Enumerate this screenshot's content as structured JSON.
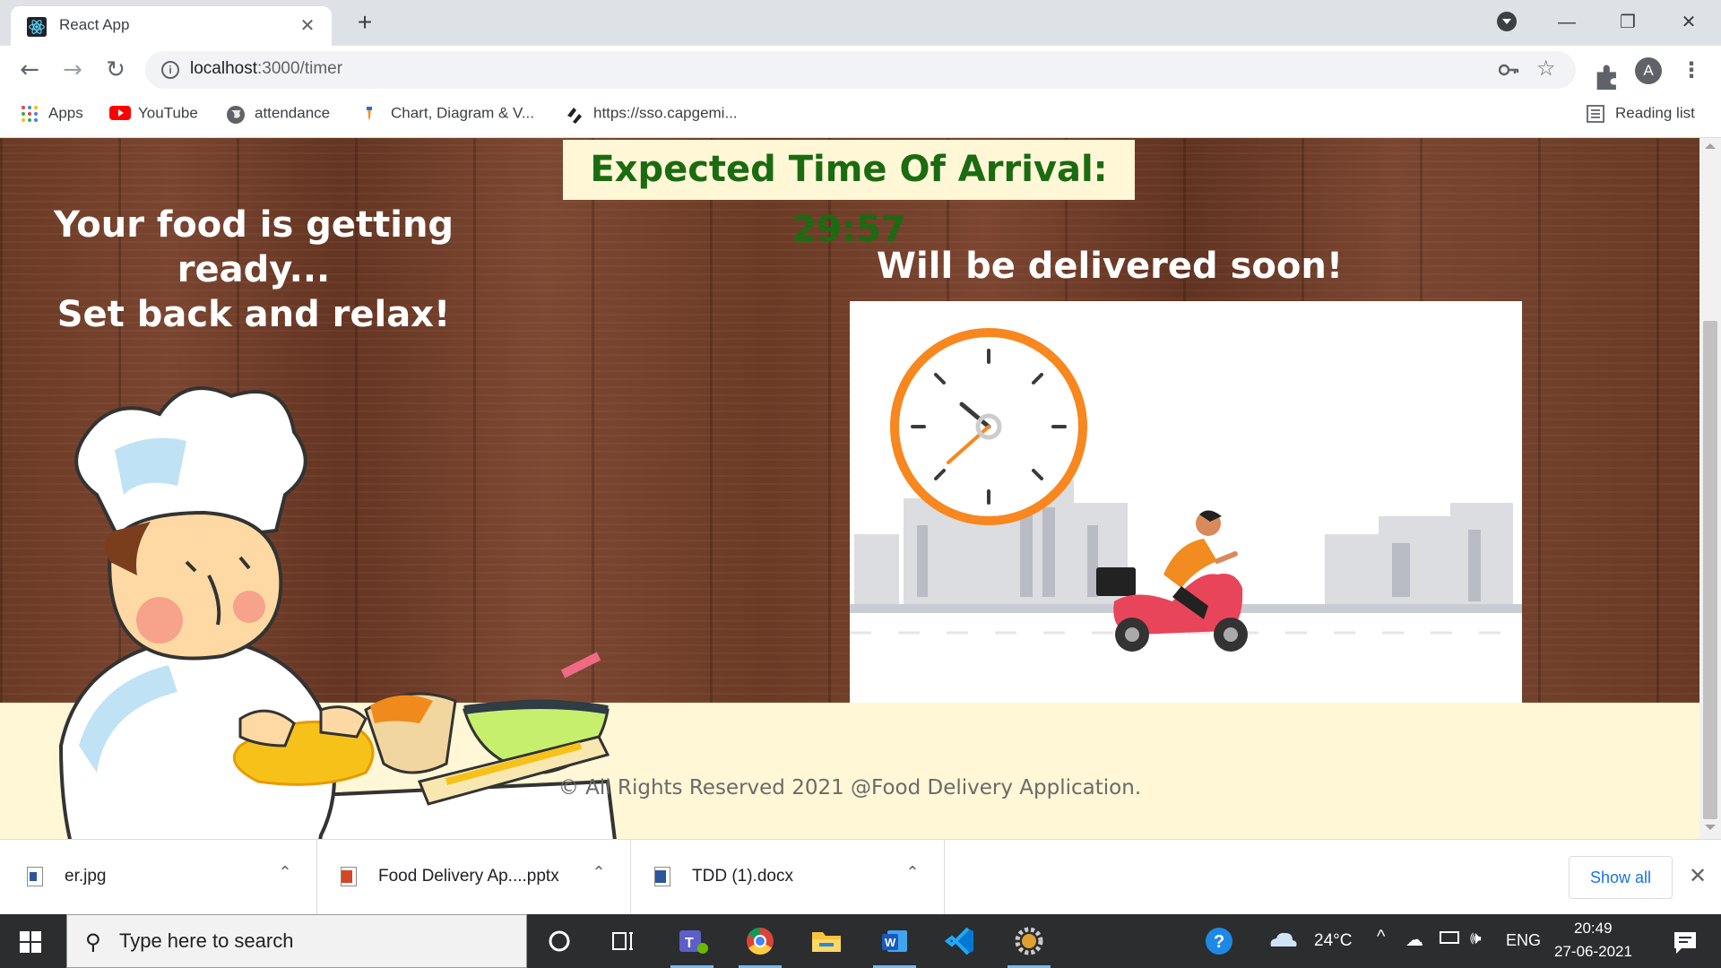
{
  "browser": {
    "tab_title": "React App",
    "url_host": "localhost",
    "url_path": ":3000/timer",
    "profile_initial": "A",
    "bookmarks": [
      {
        "label": "Apps",
        "icon": "apps-grid-icon"
      },
      {
        "label": "YouTube",
        "icon": "youtube-icon"
      },
      {
        "label": "attendance",
        "icon": "globe-icon"
      },
      {
        "label": "Chart, Diagram & V...",
        "icon": "pen-icon"
      },
      {
        "label": "https://sso.capgemi...",
        "icon": "sso-logo-icon"
      }
    ],
    "reading_list": "Reading list"
  },
  "page": {
    "eta_label": "Expected Time Of Arrival: 29:57",
    "left_heading_line1": "Your food is getting ready...",
    "left_heading_line2": "Set back and relax!",
    "right_heading": "Will be delivered soon!",
    "footer": "© All Rights Reserved 2021 @Food Delivery Application."
  },
  "downloads": {
    "items": [
      {
        "name": "er.jpg",
        "icon": "image-file-icon",
        "color": "#2b579a"
      },
      {
        "name": "Food Delivery Ap....pptx",
        "icon": "powerpoint-file-icon",
        "color": "#d24726"
      },
      {
        "name": "TDD (1).docx",
        "icon": "word-file-icon",
        "color": "#2b579a"
      }
    ],
    "show_all": "Show all"
  },
  "taskbar": {
    "search_placeholder": "Type here to search",
    "temperature": "24°C",
    "language": "ENG",
    "time": "20:49",
    "date": "27-06-2021"
  },
  "colors": {
    "eta_text": "#1b6b10",
    "eta_bg": "#fff7d6",
    "footer_bg": "#fff7d6",
    "wood": "#6b3a24",
    "clock_orange": "#f7871e",
    "scooter_red": "#e8455a"
  }
}
